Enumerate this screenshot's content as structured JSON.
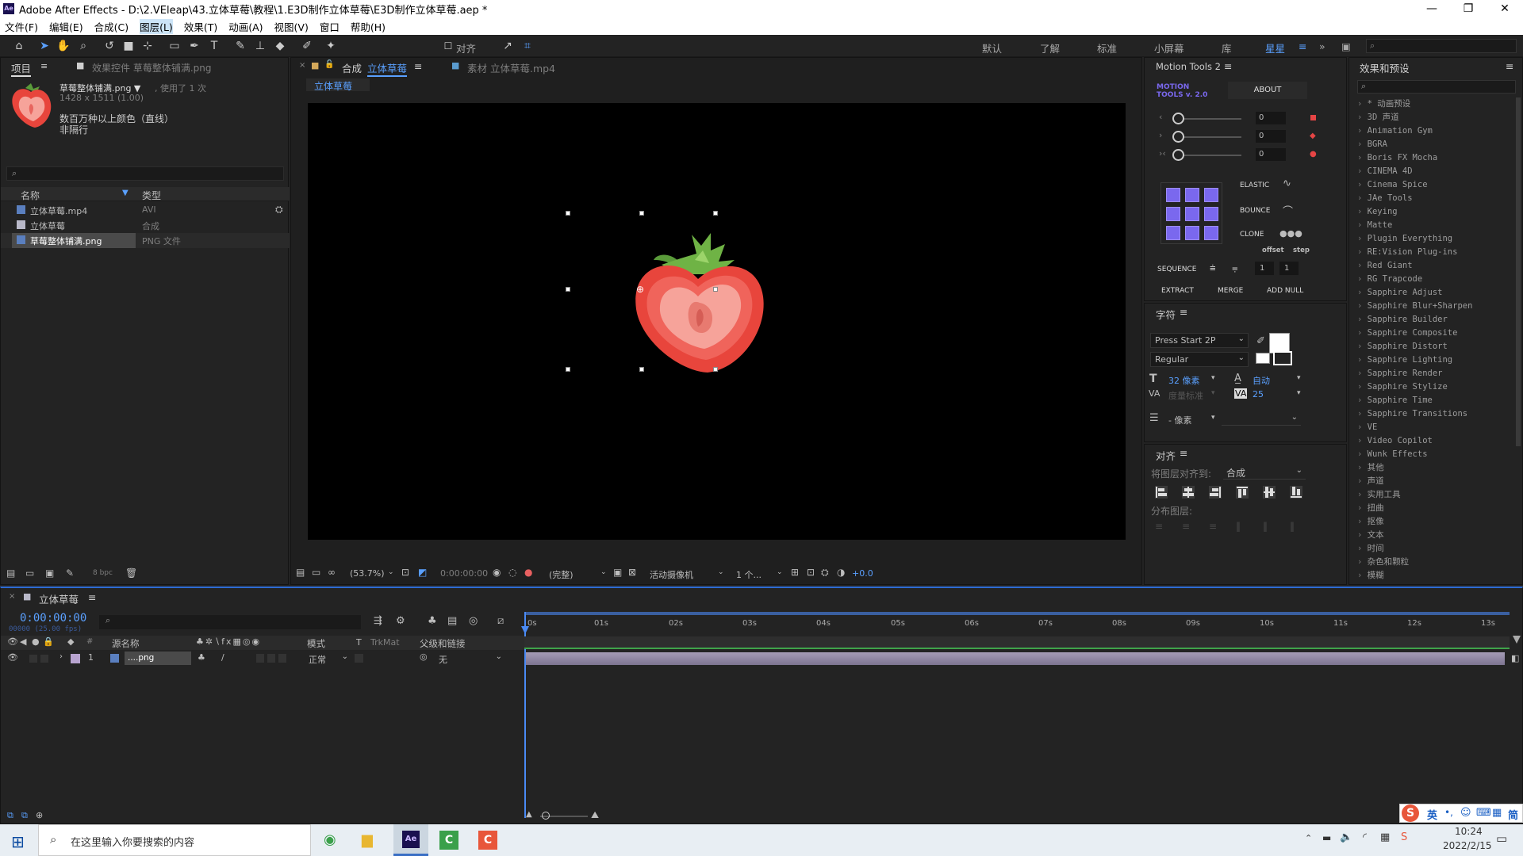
{
  "titlebar": {
    "logo": "Ae",
    "title": "Adobe After Effects - D:\\2.VEleap\\43.立体草莓\\教程\\1.E3D制作立体草莓\\E3D制作立体草莓.aep *",
    "min": "—",
    "max": "❐",
    "close": "✕"
  },
  "menu": [
    "文件(F)",
    "编辑(E)",
    "合成(C)",
    "图层(L)",
    "效果(T)",
    "动画(A)",
    "视图(V)",
    "窗口",
    "帮助(H)"
  ],
  "toolbar": {
    "snap": "对齐",
    "workspaces": [
      "默认",
      "了解",
      "标准",
      "小屏幕",
      "库",
      "星星"
    ],
    "more": "»"
  },
  "project": {
    "tab": "项目",
    "fx_tab": "效果控件 草莓整体铺满.png",
    "asset_name": "草莓整体铺满.png ▼",
    "used": ", 使用了 1 次",
    "dims": "1428 x 1511 (1.00)",
    "color_desc": "数百万种以上颜色（直线）",
    "interlace": "非隔行",
    "col_name": "名称",
    "col_type": "类型",
    "items": [
      {
        "name": "立体草莓.mp4",
        "type": "AVI"
      },
      {
        "name": "立体草莓",
        "type": "合成"
      },
      {
        "name": "草莓整体铺满.png",
        "type": "PNG 文件"
      }
    ],
    "bpc": "8 bpc"
  },
  "comp": {
    "tab_prefix": "合成",
    "tab_name": "立体草莓",
    "footage_tab": "素材 立体草莓.mp4",
    "breadcrumb": "立体草莓",
    "zoom": "(53.7%)",
    "timecode": "0:00:00:00",
    "quality": "(完整)",
    "camera": "活动摄像机",
    "views": "1 个...",
    "exposure": "+0.0"
  },
  "motion_tools": {
    "title": "Motion Tools 2",
    "logo1": "MOTION",
    "logo2": "TOOLS v. 2.0",
    "about": "ABOUT",
    "sliders": [
      {
        "value": "0",
        "label": "‹"
      },
      {
        "value": "0",
        "label": "›"
      },
      {
        "value": "0",
        "label": "›‹"
      }
    ],
    "elastic": "ELASTIC",
    "bounce": "BOUNCE",
    "clone": "CLONE",
    "offset": "offset",
    "step": "step",
    "sequence": "SEQUENCE",
    "seq_offset": "1",
    "seq_step": "1",
    "extract": "EXTRACT",
    "merge": "MERGE",
    "add_null": "ADD NULL"
  },
  "character": {
    "title": "字符",
    "font": "Press Start 2P",
    "style": "Regular",
    "size": "32 像素",
    "leading": "自动",
    "kerning": "度量标准",
    "tracking": "25",
    "stroke": "- 像素"
  },
  "align": {
    "title": "对齐",
    "align_to_label": "将图层对齐到:",
    "align_to": "合成",
    "distribute": "分布图层:"
  },
  "effects": {
    "title": "效果和预设",
    "items": [
      "* 动画预设",
      "3D 声道",
      "Animation Gym",
      "BGRA",
      "Boris FX Mocha",
      "CINEMA 4D",
      "Cinema Spice",
      "JAe Tools",
      "Keying",
      "Matte",
      "Plugin Everything",
      "RE:Vision Plug-ins",
      "Red Giant",
      "RG Trapcode",
      "Sapphire Adjust",
      "Sapphire Blur+Sharpen",
      "Sapphire Builder",
      "Sapphire Composite",
      "Sapphire Distort",
      "Sapphire Lighting",
      "Sapphire Render",
      "Sapphire Stylize",
      "Sapphire Time",
      "Sapphire Transitions",
      "VE",
      "Video Copilot",
      "Wunk Effects",
      "其他",
      "声道",
      "实用工具",
      "扭曲",
      "抠像",
      "文本",
      "时间",
      "杂色和颗粒",
      "模糊"
    ]
  },
  "timeline": {
    "tab": "立体草莓",
    "timecode": "0:00:00:00",
    "fps": "00000 (25.00 fps)",
    "ticks": [
      "0s",
      "01s",
      "02s",
      "03s",
      "04s",
      "05s",
      "06s",
      "07s",
      "08s",
      "09s",
      "10s",
      "11s",
      "12s",
      "13s"
    ],
    "col_source": "源名称",
    "col_mode": "模式",
    "col_t": "T",
    "col_trkmat": "TrkMat",
    "col_parent": "父级和链接",
    "col_num": "#",
    "layer": {
      "num": "1",
      "name": "....png",
      "mode": "正常",
      "parent": "无"
    }
  },
  "taskbar": {
    "search": "在这里输入你要搜索的内容",
    "time": "10:24",
    "date": "2022/2/15",
    "ime": "英",
    "ime2": "简"
  },
  "colors": {
    "accent": "#2d8ceb",
    "purple": "#7a68ee",
    "strawberry": "#e8453c",
    "leaf": "#5a9b3a"
  }
}
